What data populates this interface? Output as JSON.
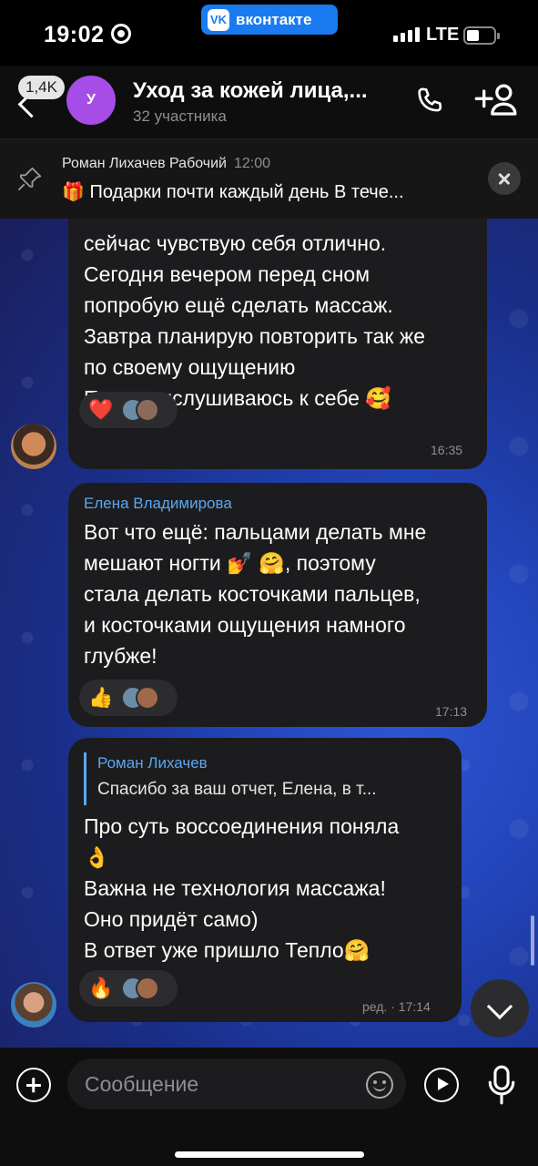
{
  "status_bar": {
    "time": "19:02",
    "network": "LTE",
    "app_pill": "вконтакте",
    "app_pill_logo": "VK"
  },
  "header": {
    "back_badge": "1,4K",
    "avatar_letter": "У",
    "title": "Уход за кожей лица,...",
    "subtitle": "32 участника",
    "icons": [
      "phone-icon",
      "add-user-icon"
    ]
  },
  "pinned": {
    "author": "Роман Лихачев Рабочий",
    "time": "12:00",
    "text": "🎁 Подарки почти каждый день В тече..."
  },
  "messages": [
    {
      "text": "сейчас чувствую себя отлично.\nСегодня вечером перед сном\nпопробую ещё сделать массаж.\nЗавтра планирую повторить так же\nпо своему ощущению\nПока прислушиваюсь к себе 🥰",
      "reaction": "❤️",
      "time": "16:35"
    },
    {
      "sender": "Елена Владимирова",
      "text": "Вот что ещё: пальцами делать мне\nмешают ногти 💅 🤗, поэтому\nстала делать косточками пальцев,\nи косточками ощущения намного\nглубже!",
      "reaction": "👍",
      "time": "17:13"
    },
    {
      "reply_author": "Роман Лихачев",
      "reply_text": "Спасибо за ваш отчет, Елена, в т...",
      "text": "Про суть воссоединения поняла\n👌\nВажна не технология массажа!\nОно придёт само)\nВ ответ уже пришло Тепло🤗",
      "reaction": "🔥",
      "time": "ред. · 17:14"
    }
  ],
  "composer": {
    "placeholder": "Сообщение"
  },
  "colors": {
    "accent": "#1a7bf0",
    "link": "#5aa8f0",
    "bubble": "#1c1c1e",
    "group_avatar": "#a54de6"
  }
}
